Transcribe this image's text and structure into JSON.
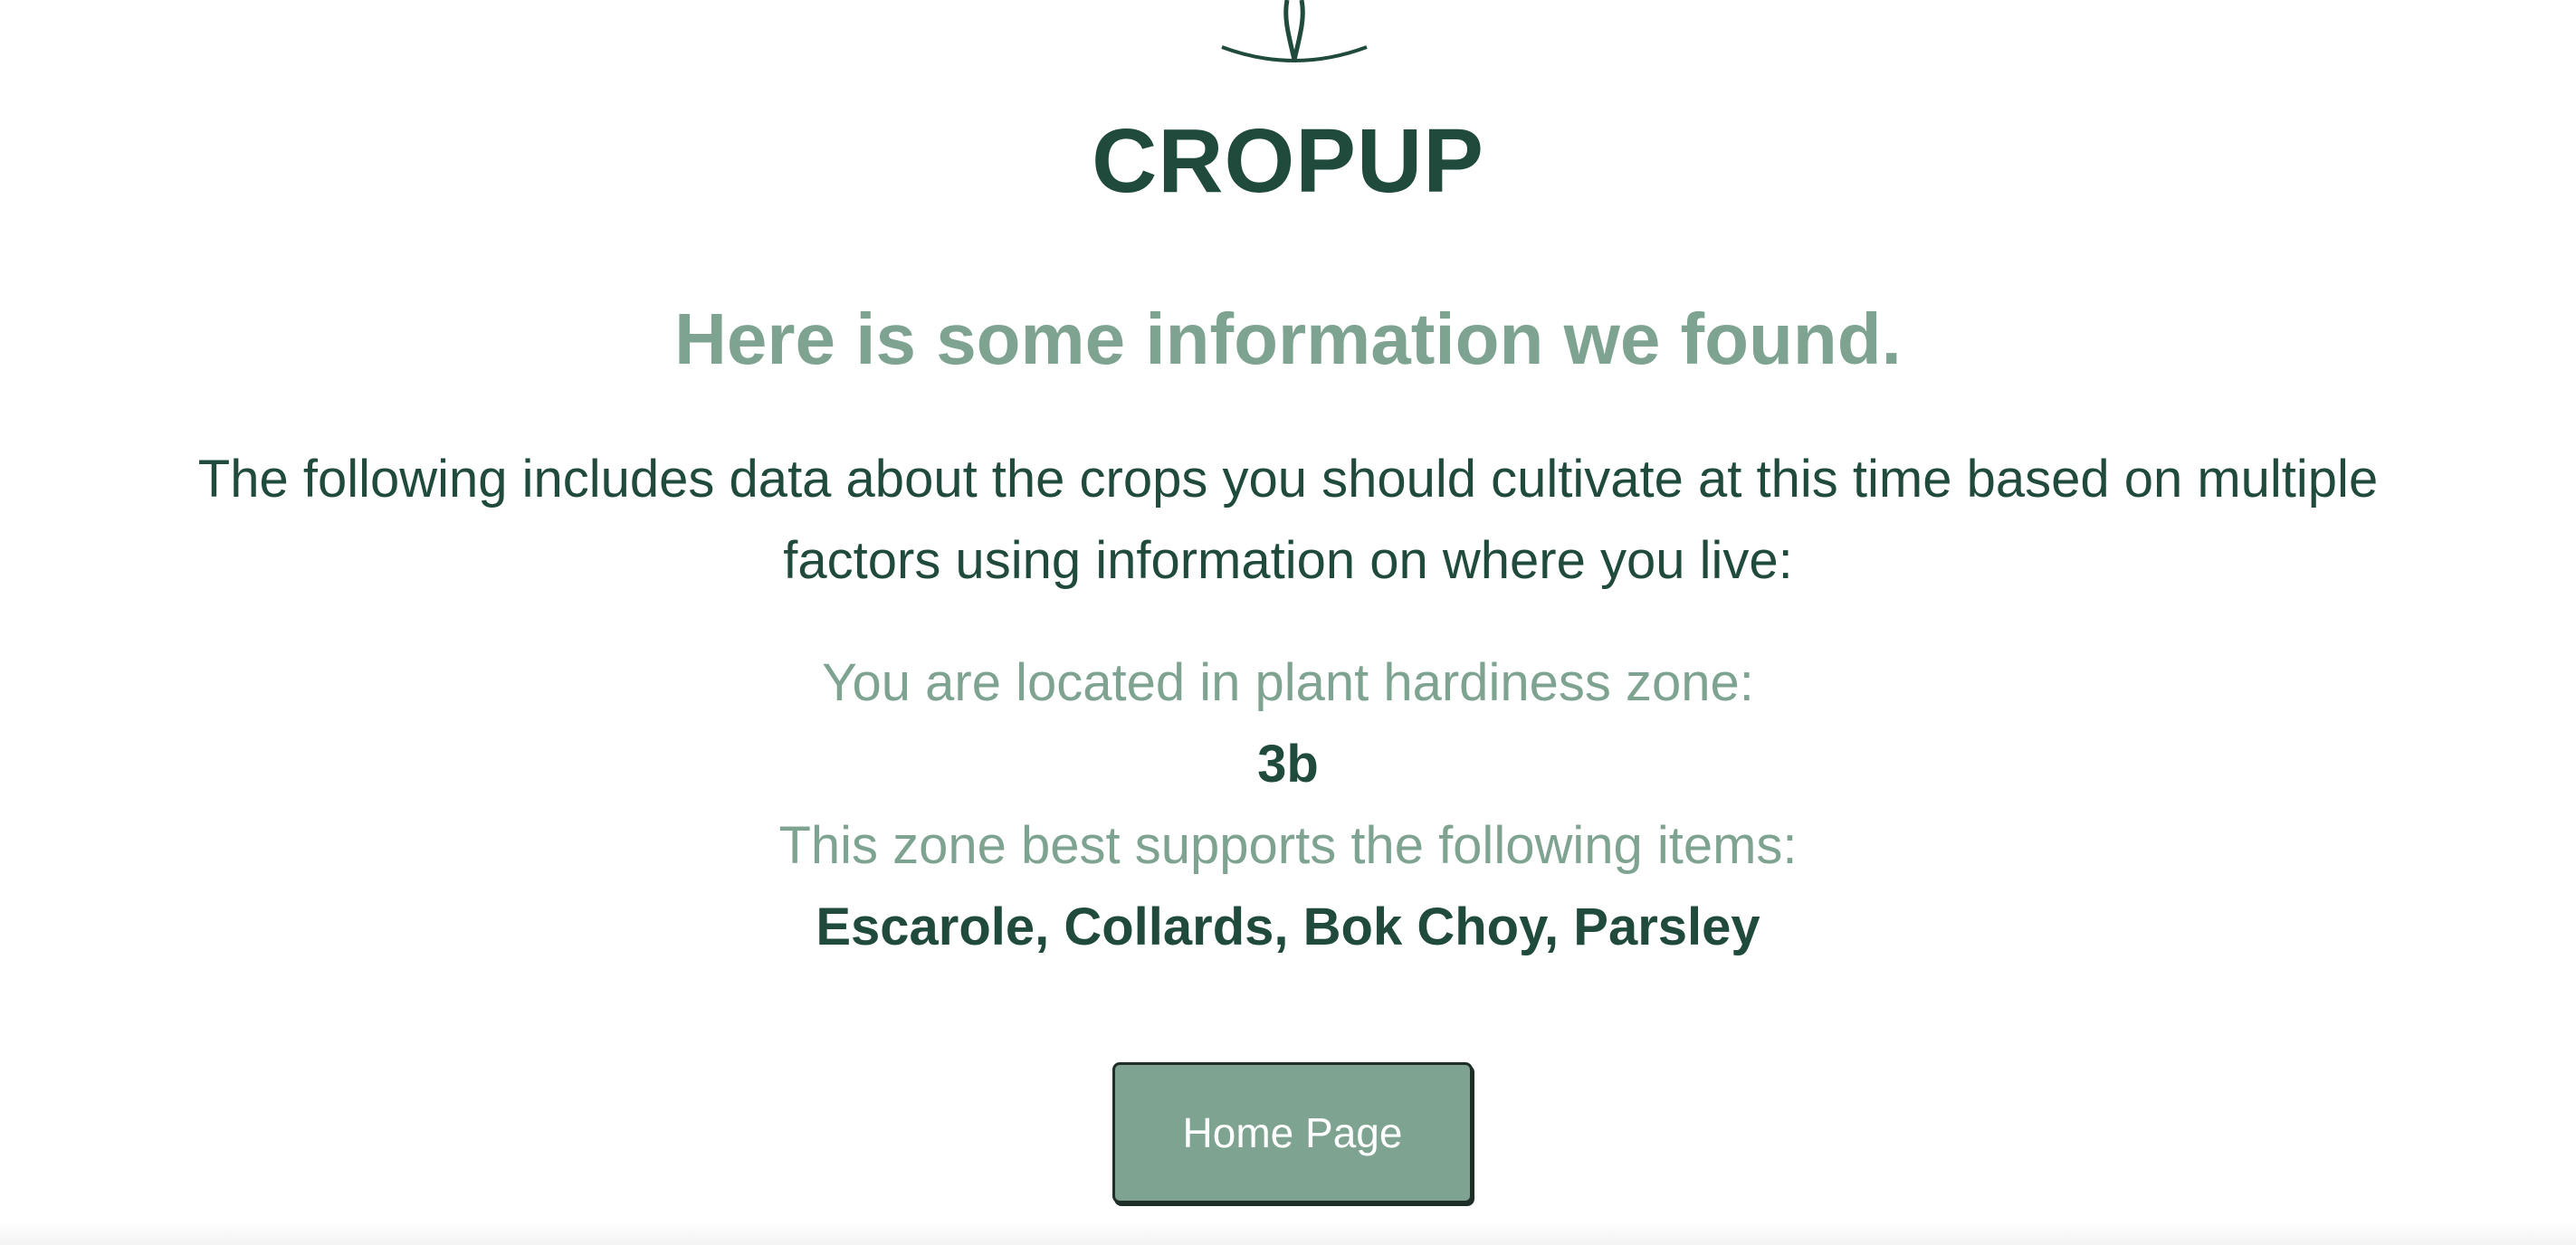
{
  "brand": {
    "name": "CROPUP",
    "logo_icon": "sprout-logo-icon",
    "color": "#1f4a3c"
  },
  "headline": "Here is some information we found.",
  "intro": "The following includes data about the crops you should cultivate at this time based on multiple factors using information on where you live:",
  "zone": {
    "label": "You are located in plant hardiness zone:",
    "value": "3b"
  },
  "items": {
    "label": "This zone best supports the following items:",
    "value": "Escarole, Collards, Bok Choy, Parsley"
  },
  "home_button": {
    "label": "Home Page",
    "color": "#7fa391"
  }
}
